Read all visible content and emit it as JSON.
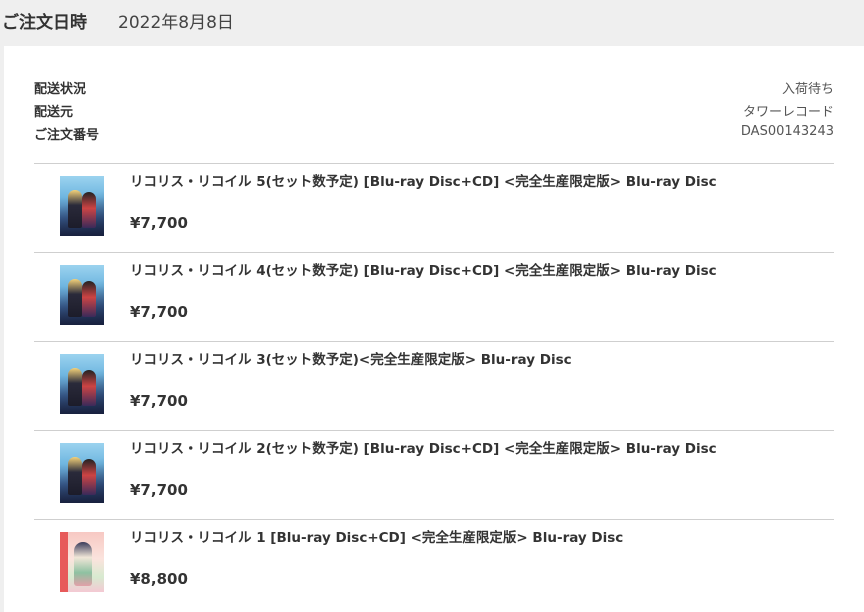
{
  "order": {
    "date_label": "ご注文日時",
    "date_value": "2022年8月8日"
  },
  "info": [
    {
      "label": "配送状況",
      "value": "入荷待ち"
    },
    {
      "label": "配送元",
      "value": "タワーレコード"
    },
    {
      "label": "ご注文番号",
      "value": "DAS00143243"
    }
  ],
  "items": [
    {
      "title": "リコリス・リコイル 5(セット数予定) [Blu-ray Disc+CD] <完全生産限定版> Blu-ray Disc",
      "price": "¥7,700",
      "cover": "blue"
    },
    {
      "title": "リコリス・リコイル 4(セット数予定) [Blu-ray Disc+CD] <完全生産限定版> Blu-ray Disc",
      "price": "¥7,700",
      "cover": "blue"
    },
    {
      "title": "リコリス・リコイル 3(セット数予定)<完全生産限定版> Blu-ray Disc",
      "price": "¥7,700",
      "cover": "blue"
    },
    {
      "title": "リコリス・リコイル 2(セット数予定) [Blu-ray Disc+CD] <完全生産限定版> Blu-ray Disc",
      "price": "¥7,700",
      "cover": "blue"
    },
    {
      "title": "リコリス・リコイル 1 [Blu-ray Disc+CD] <完全生産限定版> Blu-ray Disc",
      "price": "¥8,800",
      "cover": "pink"
    }
  ]
}
